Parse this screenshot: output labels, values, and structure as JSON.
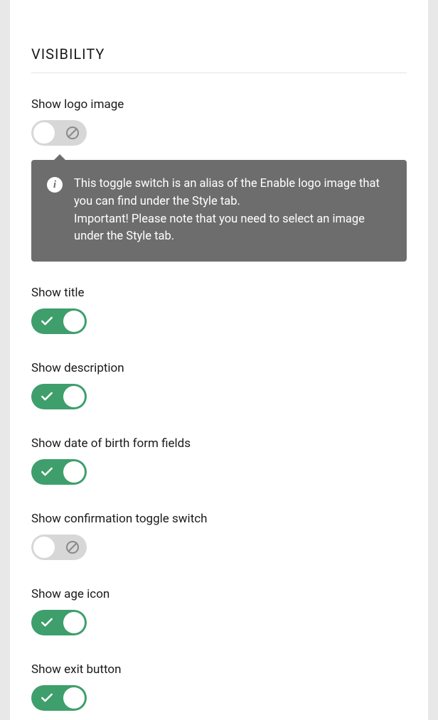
{
  "section": {
    "title": "VISIBILITY"
  },
  "tooltip": {
    "line1": "This toggle switch is an alias of the Enable logo image that you can find under the Style tab.",
    "line2": "Important! Please note that you need to select an image under the Style tab."
  },
  "fields": {
    "logo": {
      "label": "Show logo image",
      "on": false
    },
    "title": {
      "label": "Show title",
      "on": true
    },
    "description": {
      "label": "Show description",
      "on": true
    },
    "dob": {
      "label": "Show date of birth form fields",
      "on": true
    },
    "confirm": {
      "label": "Show confirmation toggle switch",
      "on": false
    },
    "ageicon": {
      "label": "Show age icon",
      "on": true
    },
    "exit": {
      "label": "Show exit button",
      "on": true
    }
  }
}
